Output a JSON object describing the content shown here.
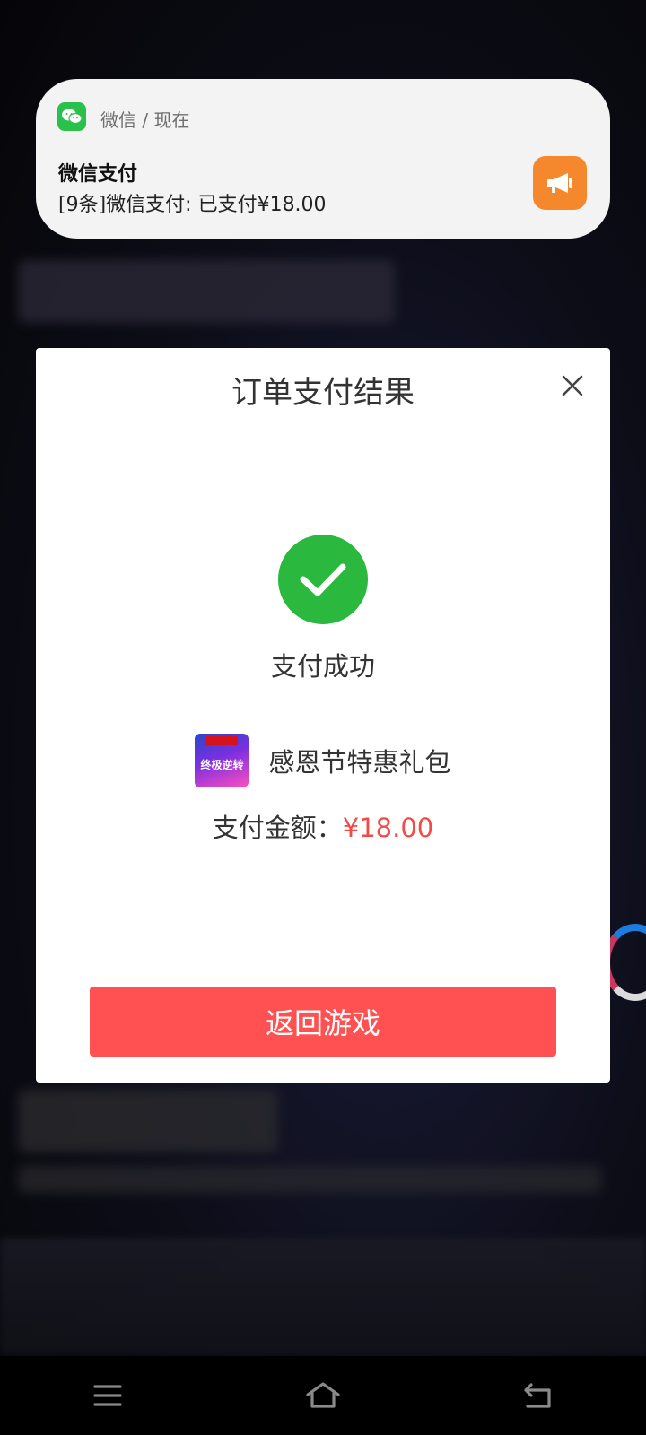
{
  "notification": {
    "app_name": "微信 / 现在",
    "title": "微信支付",
    "body": "[9条]微信支付: 已支付¥18.00",
    "app_icon": "wechat-icon",
    "action_icon": "megaphone-icon",
    "app_color": "#29c14b",
    "action_color": "#f5882c"
  },
  "dialog": {
    "title": "订单支付结果",
    "status": "支付成功",
    "product_name": "感恩节特惠礼包",
    "product_logo_text": "终极逆转",
    "amount_label": "支付金额：",
    "amount_value": "¥18.00",
    "return_button": "返回游戏",
    "success_color": "#2ab83f",
    "accent_color": "#ff5152"
  },
  "navbar": {
    "items": [
      "menu-icon",
      "home-icon",
      "back-icon"
    ]
  }
}
